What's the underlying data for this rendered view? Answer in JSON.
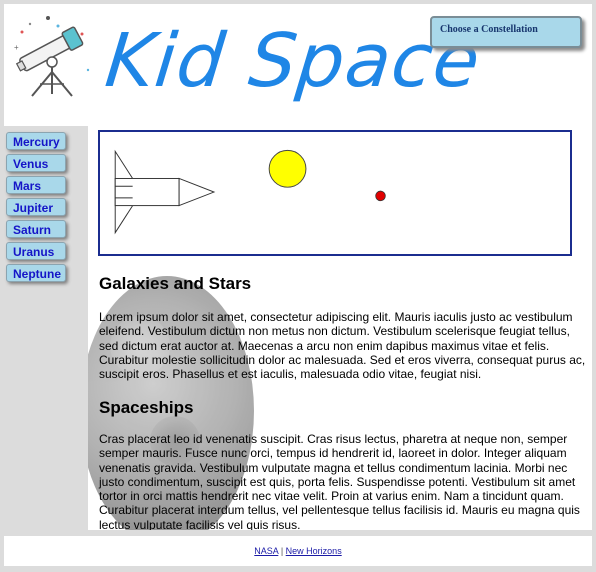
{
  "header": {
    "title": "Kid Space",
    "constellation_box": "Choose a Constellation",
    "logo_icon": "telescope-icon"
  },
  "nav": {
    "items": [
      {
        "label": "Mercury"
      },
      {
        "label": "Venus"
      },
      {
        "label": "Mars"
      },
      {
        "label": "Jupiter"
      },
      {
        "label": "Saturn"
      },
      {
        "label": "Uranus"
      },
      {
        "label": "Neptune"
      }
    ]
  },
  "scene": {
    "rocket_icon": "rocket-icon",
    "sun_color": "#ffff00",
    "planet_color": "#e00000"
  },
  "main": {
    "sections": [
      {
        "heading": "Galaxies and Stars",
        "text": "Lorem ipsum dolor sit amet, consectetur adipiscing elit. Mauris iaculis justo ac vestibulum eleifend. Vestibulum dictum non metus non dictum. Vestibulum scelerisque feugiat tellus, sed dictum erat auctor at. Maecenas a arcu non enim dapibus maximus vitae et felis. Curabitur molestie sollicitudin dolor ac malesuada. Sed et eros viverra, consequat purus ac, suscipit eros. Phasellus et est iaculis, malesuada odio vitae, feugiat nisi."
      },
      {
        "heading": "Spaceships",
        "text": "Cras placerat leo id venenatis suscipit. Cras risus lectus, pharetra at neque non, semper semper mauris. Fusce nunc orci, tempus id hendrerit id, laoreet in dolor. Integer aliquam venenatis gravida. Vestibulum vulputate magna et tellus condimentum lacinia. Morbi nec justo condimentum, suscipit est quis, porta felis. Suspendisse potenti. Vestibulum sit amet tortor in orci mattis hendrerit nec vitae velit. Proin at varius enim. Nam a tincidunt quam. Curabitur placerat interdum tellus, vel pellentesque tellus facilisis id. Mauris eu magna quis lectus vulputate facilisis vel quis risus."
      }
    ]
  },
  "footer": {
    "link1": "NASA",
    "separator": "|",
    "link2": "New Horizons"
  }
}
